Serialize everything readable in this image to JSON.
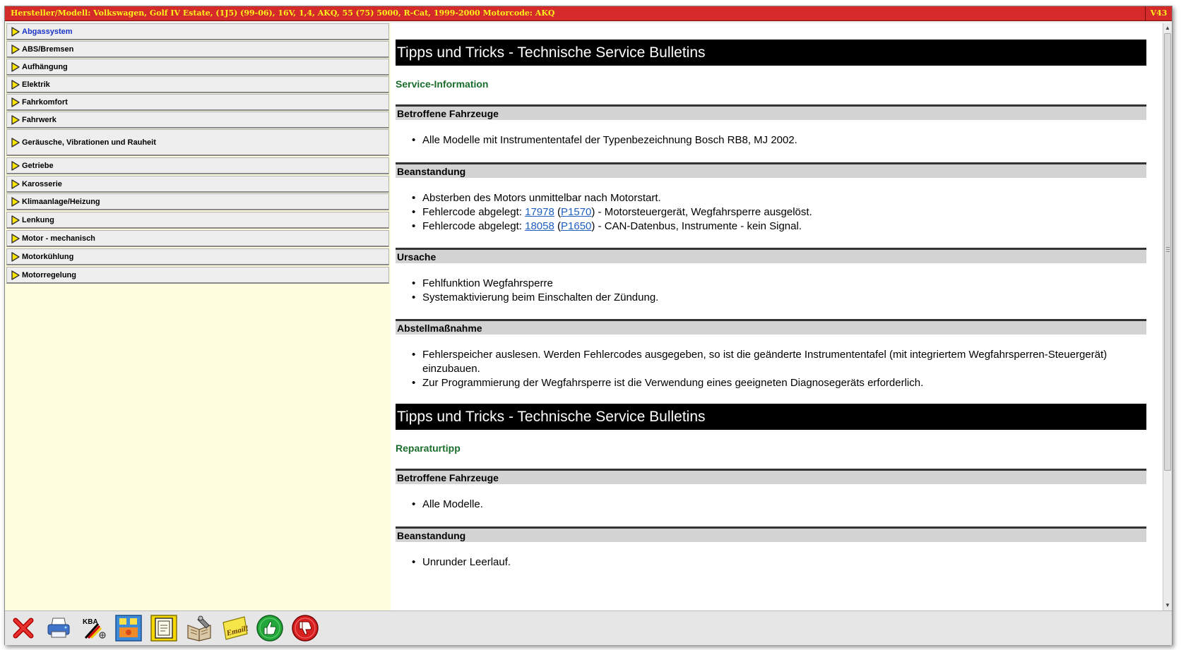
{
  "titlebar": {
    "title": "Hersteller/Modell: Volkswagen, Golf IV Estate, (1J5) (99-06), 16V, 1,4, AKQ, 55 (75) 5000, R-Cat, 1999-2000  Motorcode: AKQ",
    "version": "V43"
  },
  "sidebar": {
    "items": [
      {
        "label": "Abgassystem"
      },
      {
        "label": "ABS/Bremsen"
      },
      {
        "label": "Aufhängung"
      },
      {
        "label": "Elektrik"
      },
      {
        "label": "Fahrkomfort"
      },
      {
        "label": "Fahrwerk"
      },
      {
        "label": "Geräusche, Vibrationen und Rauheit"
      },
      {
        "label": "Getriebe"
      },
      {
        "label": "Karosserie"
      },
      {
        "label": "Klimaanlage/Heizung"
      },
      {
        "label": "Lenkung"
      },
      {
        "label": "Motor - mechanisch"
      },
      {
        "label": "Motorkühlung"
      },
      {
        "label": "Motorregelung"
      }
    ],
    "active_index": 0,
    "active_color": "#1a33c8"
  },
  "content": {
    "block1": {
      "title": "Tipps und Tricks - Technische Service Bulletins",
      "subtype": "Service-Information",
      "sections": [
        {
          "heading": "Betroffene Fahrzeuge",
          "bullets": [
            "Alle Modelle mit Instrumententafel der Typenbezeichnung Bosch RB8, MJ 2002."
          ]
        },
        {
          "heading": "Beanstandung",
          "bullets": [
            "Absterben des Motors unmittelbar nach Motorstart.",
            {
              "pre": "Fehlercode abgelegt: ",
              "code1": "17978",
              "mid": " (",
              "code2": "P1570",
              "post": ") - Motorsteuergerät, Wegfahrsperre ausgelöst."
            },
            {
              "pre": "Fehlercode abgelegt: ",
              "code1": "18058",
              "mid": " (",
              "code2": "P1650",
              "post": ") - CAN-Datenbus, Instrumente - kein Signal."
            }
          ]
        },
        {
          "heading": "Ursache",
          "bullets": [
            "Fehlfunktion Wegfahrsperre",
            "Systemaktivierung beim Einschalten der Zündung."
          ]
        },
        {
          "heading": "Abstellmaßnahme",
          "bullets": [
            "Fehlerspeicher auslesen. Werden Fehlercodes ausgegeben, so ist die geänderte Instrumententafel (mit integriertem Wegfahrsperren-Steuergerät) einzubauen.",
            "Zur Programmierung der Wegfahrsperre ist die Verwendung eines geeigneten Diagnosegeräts erforderlich."
          ]
        }
      ]
    },
    "block2": {
      "title": "Tipps und Tricks - Technische Service Bulletins",
      "subtype": "Reparaturtipp",
      "sections": [
        {
          "heading": "Betroffene Fahrzeuge",
          "bullets": [
            "Alle Modelle."
          ]
        },
        {
          "heading": "Beanstandung",
          "bullets": [
            "Unrunder Leerlauf."
          ]
        }
      ]
    }
  },
  "toolbar": {
    "buttons": [
      {
        "icon": "close-icon"
      },
      {
        "icon": "print-icon"
      },
      {
        "icon": "kba-icon",
        "label": "KBA"
      },
      {
        "icon": "panel-icon"
      },
      {
        "icon": "document-frame-icon"
      },
      {
        "icon": "manual-book-icon"
      },
      {
        "icon": "email-icon",
        "label": "Email!"
      },
      {
        "icon": "thumbs-up-icon"
      },
      {
        "icon": "thumbs-down-icon"
      }
    ]
  },
  "colors": {
    "titlebar_bg": "#d42a2a",
    "titlebar_text": "#ffef1a",
    "sidebar_bg": "#ffffe0",
    "subtype_green": "#1a6e2c",
    "link_blue": "#1f5fbf"
  }
}
